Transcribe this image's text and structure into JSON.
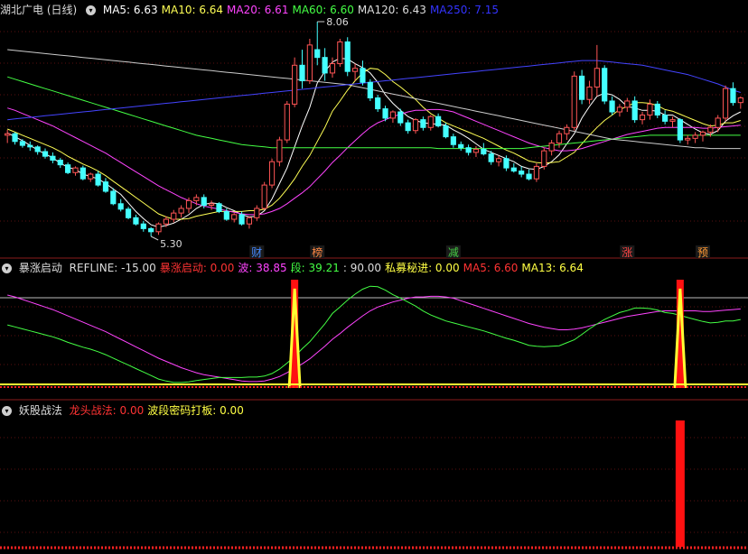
{
  "main": {
    "title": "湖北广电 (日线)",
    "ma": [
      {
        "label": "MA5: 6.63",
        "color": "#ffffff"
      },
      {
        "label": "MA10: 6.64",
        "color": "#ffff55"
      },
      {
        "label": "MA20: 6.61",
        "color": "#ff44ff"
      },
      {
        "label": "MA60: 6.60",
        "color": "#44ff44"
      },
      {
        "label": "MA120: 6.43",
        "color": "#dddddd"
      },
      {
        "label": "MA250: 7.15",
        "color": "#3333ff"
      }
    ],
    "high_label": "8.06",
    "low_label": "5.30",
    "markers": [
      {
        "text": "财",
        "color": "#4488ff"
      },
      {
        "text": "榜",
        "color": "#ff8844"
      },
      {
        "text": "减",
        "color": "#44cc44"
      },
      {
        "text": "涨",
        "color": "#ff4444"
      },
      {
        "text": "预",
        "color": "#ff9933"
      }
    ]
  },
  "ind1": {
    "title": "暴涨启动",
    "items": [
      {
        "label": "REFLINE: -15.00",
        "color": "#dddddd"
      },
      {
        "label": "暴涨启动: 0.00",
        "color": "#ff3333"
      },
      {
        "label": "波: 38.85",
        "color": "#ff44ff"
      },
      {
        "label": "段: 39.21",
        "color": "#44ff44"
      },
      {
        "label": ": 90.00",
        "color": "#dddddd"
      },
      {
        "label": "私募秘进: 0.00",
        "color": "#ffff44"
      },
      {
        "label": "MA5: 6.60",
        "color": "#ff3333"
      },
      {
        "label": "MA13: 6.64",
        "color": "#ffff44"
      }
    ]
  },
  "ind2": {
    "title": "妖股战法",
    "items": [
      {
        "label": "龙头战法: 0.00",
        "color": "#ff3333"
      },
      {
        "label": "波段密码打板: 0.00",
        "color": "#ffff44"
      }
    ]
  },
  "chart_data": {
    "type": "candlestick",
    "y_range": [
      5.3,
      8.06
    ],
    "candles": [
      [
        6.6,
        6.67,
        6.5,
        6.62
      ],
      [
        6.62,
        6.64,
        6.48,
        6.52
      ],
      [
        6.52,
        6.55,
        6.44,
        6.47
      ],
      [
        6.47,
        6.52,
        6.4,
        6.45
      ],
      [
        6.45,
        6.47,
        6.35,
        6.39
      ],
      [
        6.39,
        6.43,
        6.3,
        6.33
      ],
      [
        6.33,
        6.38,
        6.24,
        6.28
      ],
      [
        6.28,
        6.31,
        6.18,
        6.22
      ],
      [
        6.22,
        6.25,
        6.1,
        6.12
      ],
      [
        6.12,
        6.2,
        6.08,
        6.18
      ],
      [
        6.18,
        6.21,
        6.02,
        6.04
      ],
      [
        6.04,
        6.12,
        6.0,
        6.1
      ],
      [
        6.1,
        6.14,
        5.94,
        5.96
      ],
      [
        6.0,
        6.05,
        5.86,
        5.88
      ],
      [
        5.88,
        5.92,
        5.7,
        5.72
      ],
      [
        5.72,
        5.78,
        5.62,
        5.65
      ],
      [
        5.65,
        5.68,
        5.52,
        5.54
      ],
      [
        5.54,
        5.58,
        5.44,
        5.46
      ],
      [
        5.46,
        5.5,
        5.36,
        5.4
      ],
      [
        5.4,
        5.42,
        5.3,
        5.36
      ],
      [
        5.36,
        5.48,
        5.32,
        5.46
      ],
      [
        5.46,
        5.56,
        5.42,
        5.52
      ],
      [
        5.52,
        5.64,
        5.48,
        5.6
      ],
      [
        5.6,
        5.7,
        5.54,
        5.66
      ],
      [
        5.66,
        5.8,
        5.6,
        5.76
      ],
      [
        5.76,
        5.84,
        5.7,
        5.8
      ],
      [
        5.8,
        5.84,
        5.66,
        5.7
      ],
      [
        5.7,
        5.76,
        5.64,
        5.72
      ],
      [
        5.72,
        5.74,
        5.6,
        5.62
      ],
      [
        5.62,
        5.66,
        5.5,
        5.52
      ],
      [
        5.52,
        5.6,
        5.48,
        5.58
      ],
      [
        5.58,
        5.62,
        5.44,
        5.46
      ],
      [
        5.46,
        5.56,
        5.4,
        5.54
      ],
      [
        5.54,
        5.7,
        5.5,
        5.66
      ],
      [
        5.66,
        6.0,
        5.64,
        5.96
      ],
      [
        5.96,
        6.3,
        5.92,
        6.26
      ],
      [
        6.26,
        6.58,
        6.2,
        6.54
      ],
      [
        6.54,
        7.04,
        6.5,
        7.0
      ],
      [
        7.0,
        7.6,
        6.96,
        7.5
      ],
      [
        7.5,
        7.7,
        7.2,
        7.3
      ],
      [
        7.3,
        7.84,
        7.26,
        7.76
      ],
      [
        7.7,
        8.06,
        7.5,
        7.6
      ],
      [
        7.6,
        7.72,
        7.3,
        7.4
      ],
      [
        7.4,
        7.6,
        7.34,
        7.52
      ],
      [
        7.52,
        7.84,
        7.48,
        7.8
      ],
      [
        7.8,
        7.86,
        7.36,
        7.42
      ],
      [
        7.42,
        7.52,
        7.3,
        7.46
      ],
      [
        7.46,
        7.56,
        7.24,
        7.28
      ],
      [
        7.28,
        7.32,
        7.04,
        7.08
      ],
      [
        7.08,
        7.12,
        6.9,
        6.94
      ],
      [
        6.94,
        6.98,
        6.78,
        6.82
      ],
      [
        6.82,
        6.92,
        6.76,
        6.9
      ],
      [
        6.9,
        6.94,
        6.72,
        6.76
      ],
      [
        6.76,
        6.8,
        6.62,
        6.66
      ],
      [
        6.66,
        6.82,
        6.62,
        6.8
      ],
      [
        6.8,
        6.84,
        6.66,
        6.7
      ],
      [
        6.7,
        6.86,
        6.66,
        6.84
      ],
      [
        6.84,
        6.88,
        6.7,
        6.72
      ],
      [
        6.72,
        6.76,
        6.56,
        6.58
      ],
      [
        6.58,
        6.62,
        6.44,
        6.48
      ],
      [
        6.48,
        6.52,
        6.4,
        6.44
      ],
      [
        6.44,
        6.48,
        6.34,
        6.38
      ],
      [
        6.38,
        6.46,
        6.32,
        6.42
      ],
      [
        6.42,
        6.5,
        6.34,
        6.36
      ],
      [
        6.36,
        6.4,
        6.22,
        6.26
      ],
      [
        6.26,
        6.34,
        6.2,
        6.3
      ],
      [
        6.3,
        6.34,
        6.14,
        6.18
      ],
      [
        6.18,
        6.24,
        6.12,
        6.14
      ],
      [
        6.14,
        6.2,
        6.06,
        6.1
      ],
      [
        6.1,
        6.16,
        6.02,
        6.04
      ],
      [
        6.04,
        6.24,
        6.0,
        6.2
      ],
      [
        6.2,
        6.44,
        6.16,
        6.4
      ],
      [
        6.4,
        6.54,
        6.34,
        6.5
      ],
      [
        6.5,
        6.66,
        6.44,
        6.62
      ],
      [
        6.62,
        6.74,
        6.54,
        6.7
      ],
      [
        6.7,
        7.42,
        6.66,
        7.36
      ],
      [
        7.36,
        7.44,
        7.0,
        7.06
      ],
      [
        7.06,
        7.3,
        7.0,
        7.22
      ],
      [
        7.22,
        7.76,
        7.1,
        7.46
      ],
      [
        7.46,
        7.5,
        7.0,
        7.04
      ],
      [
        7.04,
        7.1,
        6.86,
        6.9
      ],
      [
        6.9,
        7.0,
        6.84,
        6.96
      ],
      [
        6.96,
        7.08,
        6.9,
        7.04
      ],
      [
        7.04,
        7.1,
        6.76,
        6.8
      ],
      [
        6.8,
        6.9,
        6.74,
        6.86
      ],
      [
        6.86,
        7.06,
        6.8,
        7.0
      ],
      [
        7.0,
        7.04,
        6.82,
        6.86
      ],
      [
        6.86,
        6.92,
        6.74,
        6.78
      ],
      [
        6.78,
        6.84,
        6.7,
        6.8
      ],
      [
        6.8,
        6.82,
        6.5,
        6.54
      ],
      [
        6.54,
        6.6,
        6.48,
        6.56
      ],
      [
        6.56,
        6.64,
        6.5,
        6.6
      ],
      [
        6.6,
        6.66,
        6.52,
        6.64
      ],
      [
        6.64,
        6.74,
        6.58,
        6.7
      ],
      [
        6.7,
        6.86,
        6.64,
        6.82
      ],
      [
        6.82,
        7.24,
        6.78,
        7.2
      ],
      [
        7.2,
        7.28,
        6.98,
        7.02
      ],
      [
        7.02,
        7.1,
        6.94,
        7.08
      ]
    ],
    "ma_lines": {
      "MA5": [
        6.63,
        6.58,
        6.53,
        6.47,
        6.41,
        6.36,
        6.31,
        6.24,
        6.19,
        6.16,
        6.1,
        6.07,
        6.04,
        5.98,
        5.91,
        5.84,
        5.73,
        5.62,
        5.53,
        5.45,
        5.42,
        5.44,
        5.47,
        5.52,
        5.58,
        5.66,
        5.71,
        5.73,
        5.72,
        5.67,
        5.63,
        5.58,
        5.55,
        5.56,
        5.63,
        5.78,
        5.98,
        6.18,
        6.45,
        6.72,
        6.96,
        7.27,
        7.42,
        7.54,
        7.59,
        7.58,
        7.52,
        7.47,
        7.4,
        7.28,
        7.12,
        7.01,
        6.92,
        6.84,
        6.79,
        6.76,
        6.75,
        6.74,
        6.73,
        6.67,
        6.62,
        6.56,
        6.49,
        6.42,
        6.38,
        6.34,
        6.3,
        6.26,
        6.2,
        6.17,
        6.16,
        6.2,
        6.26,
        6.35,
        6.49,
        6.62,
        6.82,
        6.97,
        7.1,
        7.14,
        7.12,
        7.06,
        6.97,
        6.95,
        6.92,
        6.92,
        6.91,
        6.86,
        6.86,
        6.8,
        6.74,
        6.68,
        6.63,
        6.61,
        6.66,
        6.78,
        6.85,
        6.9
      ],
      "MA10": [
        6.68,
        6.64,
        6.6,
        6.56,
        6.52,
        6.48,
        6.44,
        6.39,
        6.33,
        6.28,
        6.23,
        6.19,
        6.14,
        6.08,
        6.01,
        5.94,
        5.87,
        5.8,
        5.73,
        5.66,
        5.59,
        5.55,
        5.52,
        5.52,
        5.53,
        5.56,
        5.58,
        5.6,
        5.62,
        5.62,
        5.62,
        5.62,
        5.63,
        5.63,
        5.65,
        5.7,
        5.79,
        5.91,
        6.04,
        6.2,
        6.34,
        6.52,
        6.7,
        6.91,
        7.04,
        7.18,
        7.3,
        7.4,
        7.46,
        7.45,
        7.38,
        7.29,
        7.22,
        7.14,
        7.06,
        6.96,
        6.88,
        6.82,
        6.76,
        6.72,
        6.68,
        6.64,
        6.6,
        6.56,
        6.51,
        6.46,
        6.41,
        6.37,
        6.32,
        6.27,
        6.25,
        6.24,
        6.25,
        6.26,
        6.32,
        6.38,
        6.49,
        6.6,
        6.7,
        6.79,
        6.86,
        6.93,
        6.97,
        7.02,
        7.02,
        7.01,
        6.98,
        6.93,
        6.91,
        6.87,
        6.83,
        6.79,
        6.75,
        6.72,
        6.73,
        6.76,
        6.76,
        6.79
      ],
      "MA20": [
        6.95,
        6.92,
        6.88,
        6.84,
        6.8,
        6.76,
        6.72,
        6.67,
        6.62,
        6.57,
        6.52,
        6.47,
        6.42,
        6.37,
        6.31,
        6.25,
        6.19,
        6.13,
        6.07,
        6.01,
        5.95,
        5.9,
        5.85,
        5.8,
        5.76,
        5.72,
        5.69,
        5.67,
        5.65,
        5.63,
        5.61,
        5.59,
        5.58,
        5.58,
        5.59,
        5.62,
        5.66,
        5.72,
        5.79,
        5.86,
        5.94,
        6.04,
        6.14,
        6.25,
        6.34,
        6.44,
        6.53,
        6.62,
        6.7,
        6.76,
        6.8,
        6.84,
        6.87,
        6.9,
        6.92,
        6.92,
        6.93,
        6.93,
        6.92,
        6.9,
        6.86,
        6.82,
        6.78,
        6.74,
        6.7,
        6.66,
        6.62,
        6.58,
        6.54,
        6.5,
        6.47,
        6.44,
        6.42,
        6.4,
        6.4,
        6.41,
        6.43,
        6.46,
        6.49,
        6.52,
        6.55,
        6.58,
        6.61,
        6.63,
        6.65,
        6.67,
        6.69,
        6.7,
        6.7,
        6.7,
        6.7,
        6.7,
        6.69,
        6.69,
        6.7,
        6.71,
        6.72,
        6.73
      ],
      "MA60": [
        7.35,
        7.32,
        7.29,
        7.26,
        7.23,
        7.2,
        7.17,
        7.14,
        7.11,
        7.08,
        7.05,
        7.02,
        6.99,
        6.96,
        6.93,
        6.9,
        6.87,
        6.84,
        6.81,
        6.78,
        6.75,
        6.72,
        6.69,
        6.66,
        6.63,
        6.6,
        6.58,
        6.56,
        6.54,
        6.52,
        6.5,
        6.48,
        6.47,
        6.46,
        6.45,
        6.44,
        6.44,
        6.44,
        6.44,
        6.44,
        6.44,
        6.44,
        6.44,
        6.44,
        6.44,
        6.44,
        6.44,
        6.44,
        6.44,
        6.44,
        6.44,
        6.44,
        6.44,
        6.44,
        6.44,
        6.44,
        6.44,
        6.43,
        6.43,
        6.43,
        6.43,
        6.43,
        6.43,
        6.43,
        6.43,
        6.43,
        6.43,
        6.43,
        6.43,
        6.44,
        6.45,
        6.46,
        6.47,
        6.48,
        6.49,
        6.5,
        6.51,
        6.52,
        6.53,
        6.54,
        6.55,
        6.56,
        6.57,
        6.58,
        6.59,
        6.6,
        6.6,
        6.6,
        6.6,
        6.6,
        6.6,
        6.6,
        6.6,
        6.6,
        6.6,
        6.6,
        6.6,
        6.6
      ],
      "MA120": [
        7.7,
        7.69,
        7.68,
        7.67,
        7.66,
        7.65,
        7.64,
        7.63,
        7.62,
        7.61,
        7.6,
        7.59,
        7.58,
        7.57,
        7.56,
        7.55,
        7.54,
        7.53,
        7.52,
        7.51,
        7.5,
        7.49,
        7.48,
        7.47,
        7.46,
        7.45,
        7.44,
        7.43,
        7.42,
        7.41,
        7.4,
        7.39,
        7.38,
        7.37,
        7.36,
        7.35,
        7.34,
        7.33,
        7.32,
        7.31,
        7.3,
        7.29,
        7.28,
        7.27,
        7.26,
        7.25,
        7.23,
        7.21,
        7.19,
        7.17,
        7.15,
        7.13,
        7.11,
        7.09,
        7.07,
        7.05,
        7.03,
        7.01,
        6.99,
        6.97,
        6.95,
        6.93,
        6.91,
        6.89,
        6.87,
        6.85,
        6.83,
        6.81,
        6.79,
        6.77,
        6.75,
        6.73,
        6.71,
        6.69,
        6.67,
        6.65,
        6.63,
        6.61,
        6.59,
        6.57,
        6.55,
        6.54,
        6.53,
        6.52,
        6.51,
        6.5,
        6.49,
        6.48,
        6.47,
        6.46,
        6.45,
        6.44,
        6.44,
        6.43,
        6.43,
        6.43,
        6.43,
        6.43
      ],
      "MA250": [
        6.8,
        6.81,
        6.82,
        6.83,
        6.84,
        6.85,
        6.86,
        6.87,
        6.88,
        6.89,
        6.9,
        6.91,
        6.92,
        6.93,
        6.94,
        6.95,
        6.96,
        6.97,
        6.98,
        6.99,
        7.0,
        7.01,
        7.02,
        7.03,
        7.04,
        7.05,
        7.06,
        7.07,
        7.08,
        7.09,
        7.1,
        7.11,
        7.12,
        7.13,
        7.14,
        7.15,
        7.16,
        7.17,
        7.18,
        7.19,
        7.2,
        7.21,
        7.22,
        7.23,
        7.24,
        7.25,
        7.26,
        7.27,
        7.28,
        7.29,
        7.3,
        7.31,
        7.32,
        7.33,
        7.34,
        7.35,
        7.36,
        7.37,
        7.38,
        7.39,
        7.4,
        7.41,
        7.42,
        7.43,
        7.44,
        7.45,
        7.46,
        7.47,
        7.48,
        7.49,
        7.5,
        7.51,
        7.52,
        7.53,
        7.54,
        7.55,
        7.56,
        7.56,
        7.56,
        7.55,
        7.54,
        7.53,
        7.52,
        7.51,
        7.5,
        7.48,
        7.46,
        7.44,
        7.42,
        7.4,
        7.38,
        7.35,
        7.32,
        7.29,
        7.26,
        7.22,
        7.18,
        7.15
      ]
    },
    "ind1_spikes": [
      38,
      89
    ],
    "ind2_spikes": [
      89
    ]
  }
}
